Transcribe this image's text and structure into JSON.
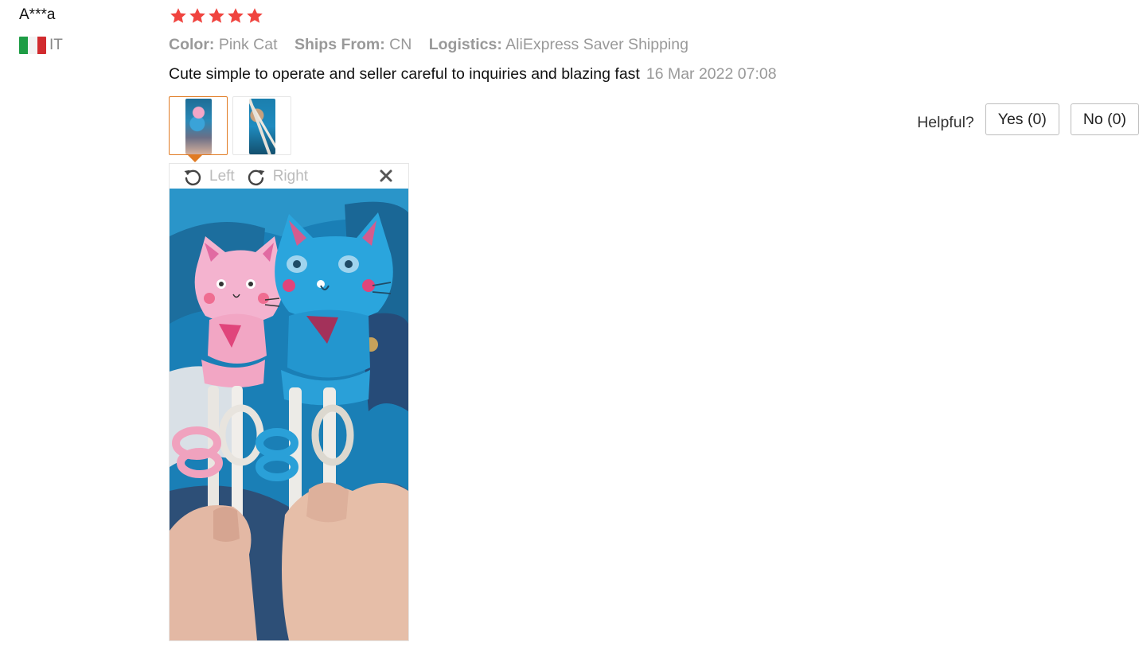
{
  "user": {
    "name": "A***a",
    "country_code": "IT",
    "flag": "italy-flag"
  },
  "rating": {
    "stars": 5,
    "max": 5,
    "color": "#f0443f"
  },
  "meta": {
    "color_key": "Color:",
    "color_value": "Pink Cat",
    "ships_key": "Ships From:",
    "ships_value": "CN",
    "logistics_key": "Logistics:",
    "logistics_value": "AliExpress Saver Shipping"
  },
  "review": {
    "text": "Cute simple to operate and seller careful to inquiries and blazing fast",
    "date": "16 Mar 2022 07:08"
  },
  "photos": {
    "thumbnails": [
      "thumbnail-1",
      "thumbnail-2"
    ],
    "active_index": 0,
    "active_border_color": "#e07b23"
  },
  "viewer": {
    "rotate_left_label": "Left",
    "rotate_right_label": "Right",
    "close_icon": "close-icon"
  },
  "helpful": {
    "label": "Helpful?",
    "yes_label": "Yes (0)",
    "no_label": "No (0)"
  }
}
